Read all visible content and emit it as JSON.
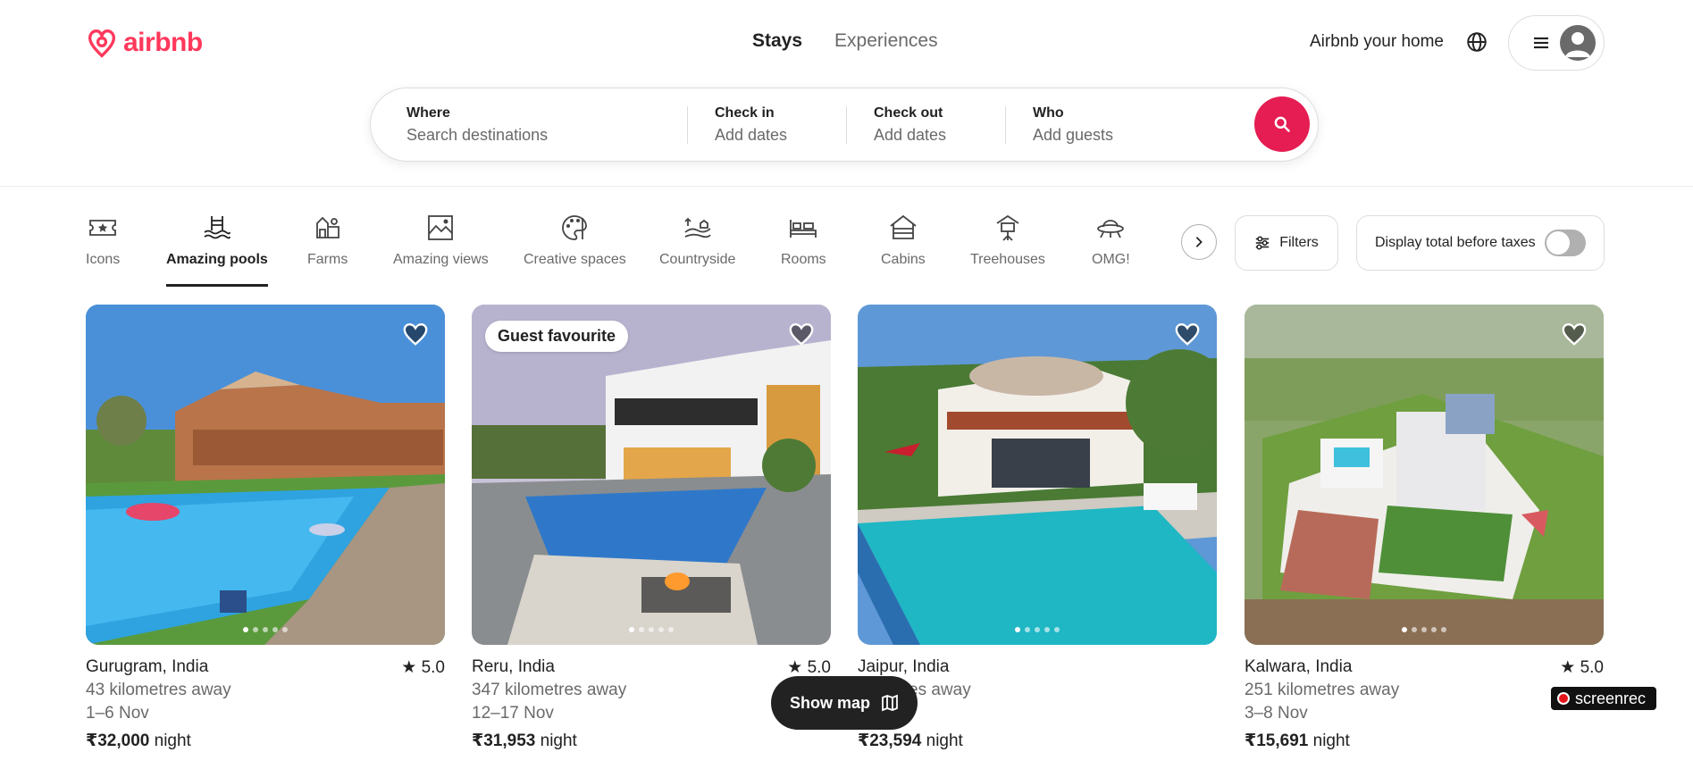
{
  "brand": {
    "name": "airbnb",
    "color": "#FF385C"
  },
  "nav": {
    "tabs": [
      {
        "label": "Stays"
      },
      {
        "label": "Experiences"
      }
    ]
  },
  "header": {
    "host_link": "Airbnb your home",
    "globe_icon": "globe-icon",
    "menu_icon": "hamburger-icon",
    "avatar_icon": "user-avatar-icon"
  },
  "search": {
    "where": {
      "label": "Where",
      "placeholder": "Search destinations"
    },
    "check_in": {
      "label": "Check in",
      "placeholder": "Add dates"
    },
    "check_out": {
      "label": "Check out",
      "placeholder": "Add dates"
    },
    "who": {
      "label": "Who",
      "placeholder": "Add guests"
    },
    "button_icon": "search-icon",
    "accent": "#E51D53"
  },
  "categories": [
    {
      "label": "Icons",
      "icon": "ticket-star-icon"
    },
    {
      "label": "Amazing pools",
      "icon": "pool-waves-icon",
      "selected": true
    },
    {
      "label": "Farms",
      "icon": "farm-barn-icon"
    },
    {
      "label": "Amazing views",
      "icon": "landscape-view-icon"
    },
    {
      "label": "Creative spaces",
      "icon": "palette-icon"
    },
    {
      "label": "Countryside",
      "icon": "countryside-icon"
    },
    {
      "label": "Rooms",
      "icon": "bed-room-icon"
    },
    {
      "label": "Cabins",
      "icon": "cabin-icon"
    },
    {
      "label": "Treehouses",
      "icon": "treehouse-icon"
    },
    {
      "label": "OMG!",
      "icon": "ufo-icon"
    }
  ],
  "filters": {
    "label": "Filters",
    "icon": "sliders-icon"
  },
  "taxes": {
    "label": "Display total before taxes",
    "enabled": false
  },
  "listings": [
    {
      "location": "Gurugram, India",
      "rating": "5.0",
      "distance": "43 kilometres away",
      "dates": "1–6 Nov",
      "price": "₹32,000",
      "price_unit": "night",
      "badge": null
    },
    {
      "location": "Reru, India",
      "rating": "5.0",
      "distance": "347 kilometres away",
      "dates": "12–17 Nov",
      "price": "₹31,953",
      "price_unit": "night",
      "badge": "Guest favourite"
    },
    {
      "location": "Jaipur, India",
      "rating": "",
      "distance": "…metres away",
      "dates": "…v",
      "price": "₹23,594",
      "price_unit": "night",
      "badge": null
    },
    {
      "location": "Kalwara, India",
      "rating": "5.0",
      "distance": "251 kilometres away",
      "dates": "3–8 Nov",
      "price": "₹15,691",
      "price_unit": "night",
      "badge": null
    }
  ],
  "show_map": {
    "label": "Show map",
    "icon": "map-icon"
  },
  "overlay": {
    "watermark": "screenrec"
  }
}
